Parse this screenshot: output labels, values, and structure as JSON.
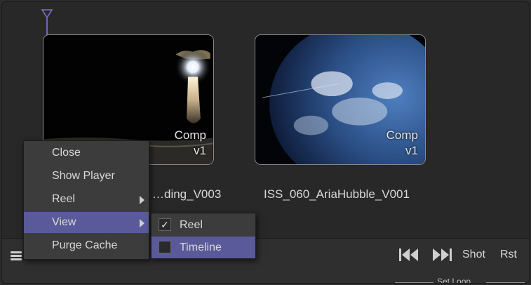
{
  "clips": [
    {
      "name": "…ding_V003",
      "type_label": "Comp",
      "version_label": "v1"
    },
    {
      "name": "ISS_060_AriaHubble_V001",
      "type_label": "Comp",
      "version_label": "v1"
    }
  ],
  "context_menu": {
    "items": [
      {
        "label": "Close",
        "has_submenu": false
      },
      {
        "label": "Show Player",
        "has_submenu": false
      },
      {
        "label": "Reel",
        "has_submenu": true
      },
      {
        "label": "View",
        "has_submenu": true,
        "highlighted": true
      },
      {
        "label": "Purge Cache",
        "has_submenu": false
      }
    ]
  },
  "view_submenu": {
    "items": [
      {
        "label": "Reel",
        "checked": true
      },
      {
        "label": "Timeline",
        "checked": false,
        "highlighted": true
      }
    ],
    "check_glyph": "✓"
  },
  "toolbar": {
    "prev_icon": "skip-to-start-icon",
    "next_icon": "skip-to-end-icon",
    "shot_label": "Shot",
    "rst_label": "Rst",
    "set_loop_label": "Set Loop"
  },
  "colors": {
    "accent": "#5a5a9a",
    "playhead": "#6d67b8"
  }
}
